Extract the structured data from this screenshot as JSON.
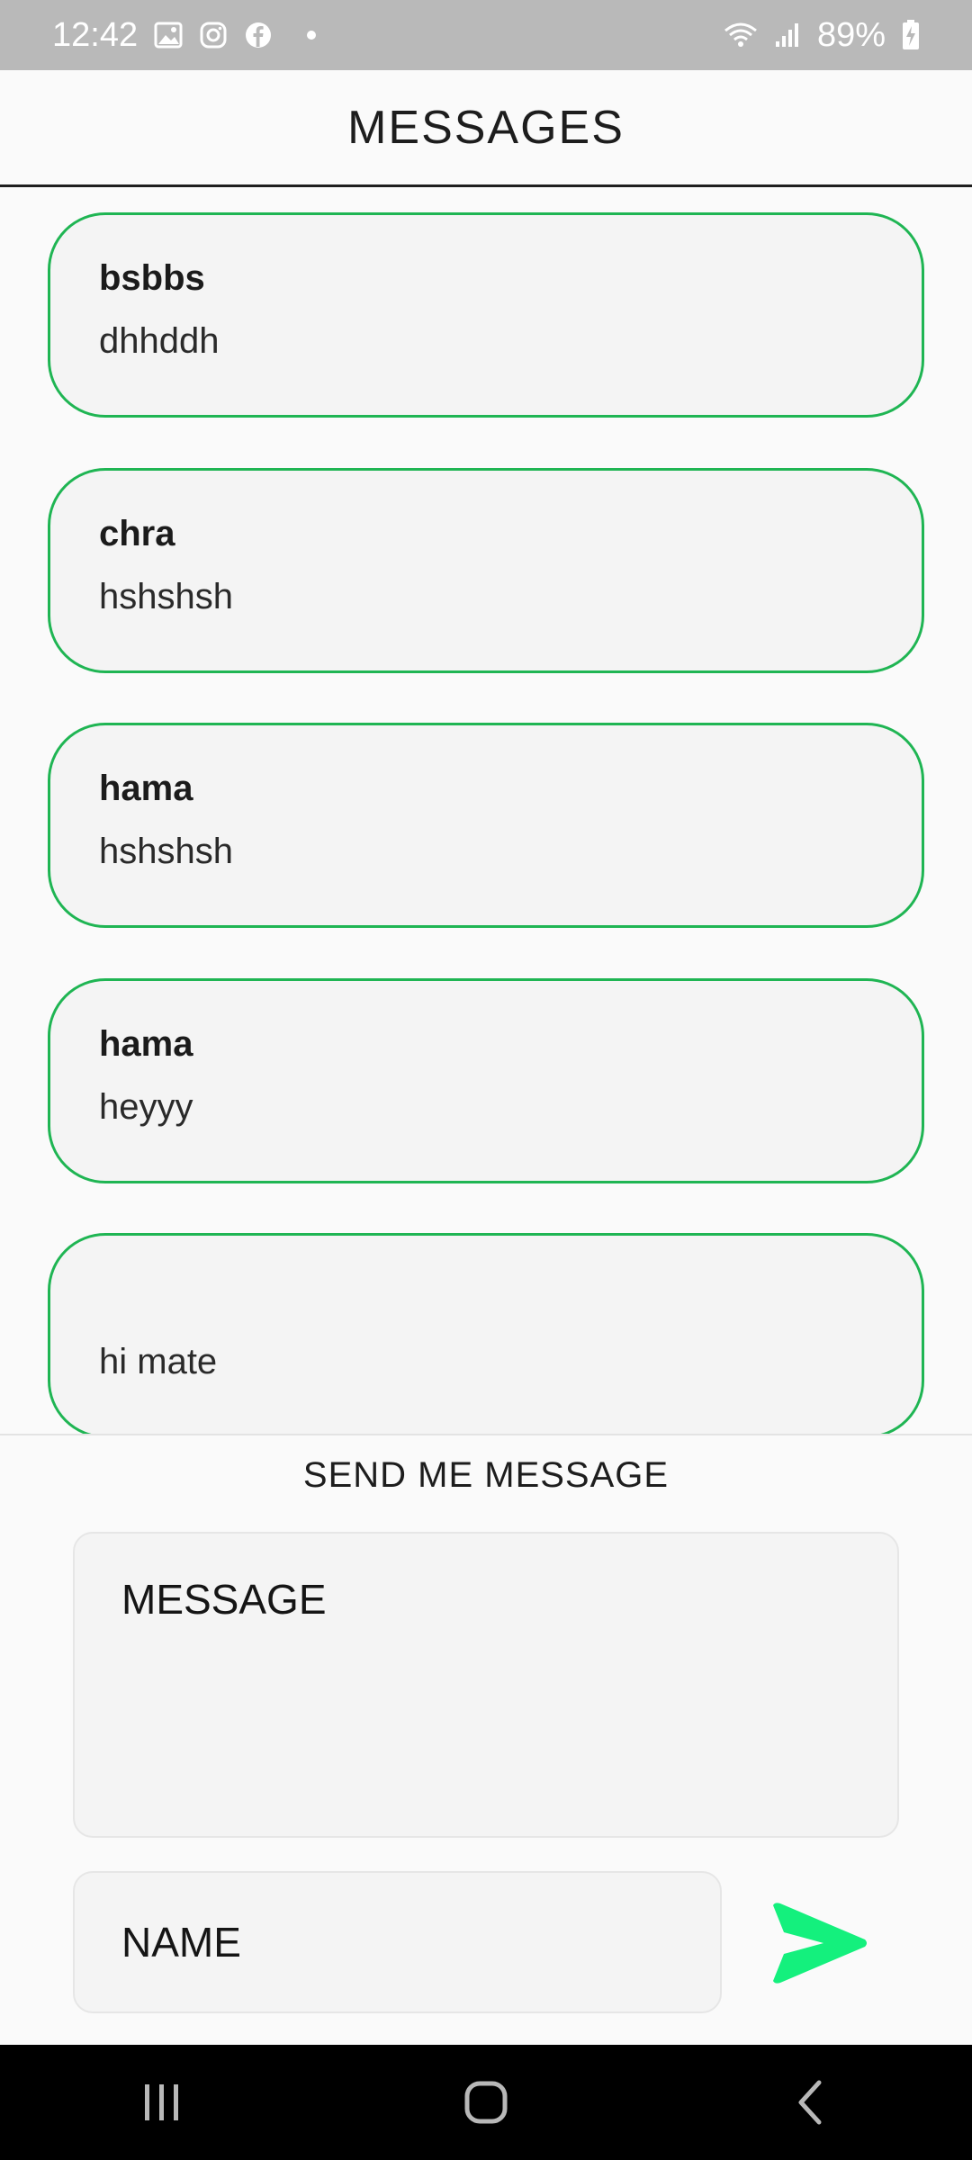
{
  "status_bar": {
    "time": "12:42",
    "battery": "89%",
    "icons": [
      "gallery-icon",
      "instagram-icon",
      "facebook-icon",
      "notification-dot-icon",
      "wifi-icon",
      "signal-icon",
      "battery-charging-icon"
    ]
  },
  "header": {
    "title": "MESSAGES"
  },
  "messages": [
    {
      "name": "bsbbs",
      "text": "dhhddh"
    },
    {
      "name": "chra",
      "text": "hshshsh"
    },
    {
      "name": "hama",
      "text": "hshshsh"
    },
    {
      "name": "hama",
      "text": "heyyy"
    },
    {
      "name": "",
      "text": "hi mate"
    }
  ],
  "send_section": {
    "title": "SEND ME MESSAGE",
    "message_placeholder": "MESSAGE",
    "name_placeholder": "NAME",
    "send_icon": "send-arrow-icon"
  },
  "nav_bar": {
    "icons": [
      "recent-apps-icon",
      "home-icon",
      "back-icon"
    ]
  },
  "colors": {
    "card_border": "#1fb553",
    "send_accent": "#14f07d",
    "status_bar_bg": "#b9b9b9"
  }
}
